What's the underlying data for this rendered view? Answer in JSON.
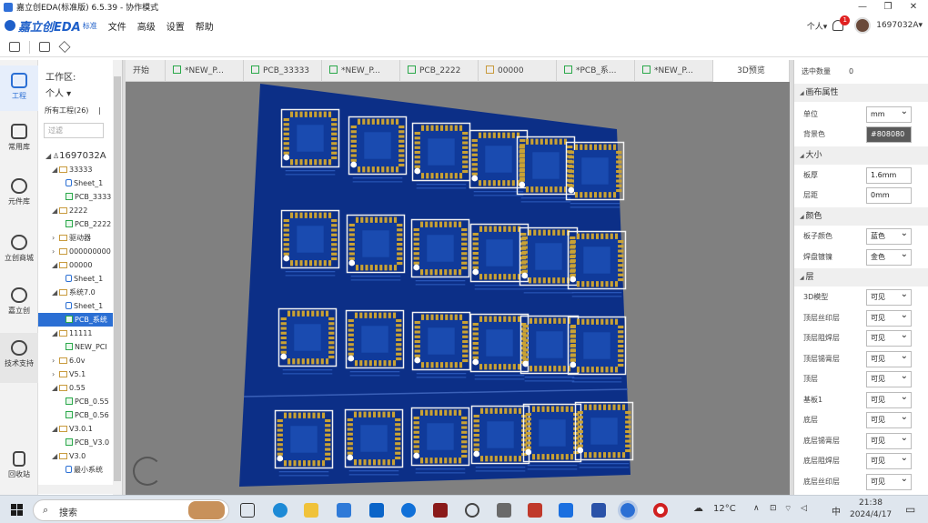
{
  "window": {
    "title": "嘉立创EDA(标准版) 6.5.39 - 协作模式",
    "minimize": "—",
    "maximize": "❐",
    "close": "✕"
  },
  "menubar": {
    "brand": "嘉立创EDA",
    "brand_suffix": "标准",
    "items": [
      "文件",
      "高级",
      "设置",
      "帮助"
    ],
    "personal": "个人▾",
    "notifications": "1",
    "username": "1697032A▾"
  },
  "rail": {
    "items": [
      {
        "label": "工程",
        "icon": "folder-icon",
        "active": true
      },
      {
        "label": "常用库",
        "icon": "library-icon"
      },
      {
        "label": "元件库",
        "icon": "component-search-icon"
      },
      {
        "label": "立创商城",
        "icon": "lcsc-store-icon"
      },
      {
        "label": "嘉立创",
        "icon": "jlc-icon"
      },
      {
        "label": "技术支持",
        "icon": "help-icon"
      },
      {
        "label": "回收站",
        "icon": "trash-icon"
      }
    ]
  },
  "project_panel": {
    "workspace_label": "工作区:",
    "workspace_value": "个人 ▾",
    "all_projects": "所有工程(26)",
    "separator": "|",
    "filter_placeholder": "过滤",
    "tree": [
      {
        "depth": 0,
        "type": "user",
        "label": "1697032A",
        "arrow": "◢"
      },
      {
        "depth": 1,
        "type": "folder",
        "label": "33333",
        "arrow": "◢"
      },
      {
        "depth": 2,
        "type": "sch",
        "label": "Sheet_1"
      },
      {
        "depth": 2,
        "type": "pcb",
        "label": "PCB_3333"
      },
      {
        "depth": 1,
        "type": "folder",
        "label": "2222",
        "arrow": "◢"
      },
      {
        "depth": 2,
        "type": "pcb",
        "label": "PCB_2222"
      },
      {
        "depth": 1,
        "type": "folder",
        "label": "驱动器",
        "arrow": "›"
      },
      {
        "depth": 1,
        "type": "folder",
        "label": "000000000",
        "arrow": "›"
      },
      {
        "depth": 1,
        "type": "folder",
        "label": "00000",
        "arrow": "◢"
      },
      {
        "depth": 2,
        "type": "sch",
        "label": "Sheet_1"
      },
      {
        "depth": 1,
        "type": "folder",
        "label": "系统7.0",
        "arrow": "◢"
      },
      {
        "depth": 2,
        "type": "sch",
        "label": "Sheet_1"
      },
      {
        "depth": 2,
        "type": "pcb",
        "label": "PCB_系统",
        "selected": true
      },
      {
        "depth": 1,
        "type": "folder",
        "label": "11111",
        "arrow": "◢"
      },
      {
        "depth": 2,
        "type": "pcb",
        "label": "NEW_PCI"
      },
      {
        "depth": 1,
        "type": "folder",
        "label": "6.0v",
        "arrow": "›"
      },
      {
        "depth": 1,
        "type": "folder",
        "label": "V5.1",
        "arrow": "›"
      },
      {
        "depth": 1,
        "type": "folder",
        "label": "0.55",
        "arrow": "◢"
      },
      {
        "depth": 2,
        "type": "pcb",
        "label": "PCB_0.55"
      },
      {
        "depth": 2,
        "type": "pcb",
        "label": "PCB_0.56"
      },
      {
        "depth": 1,
        "type": "folder",
        "label": "V3.0.1",
        "arrow": "◢"
      },
      {
        "depth": 2,
        "type": "pcb",
        "label": "PCB_V3.0"
      },
      {
        "depth": 1,
        "type": "folder",
        "label": "V3.0",
        "arrow": "◢"
      },
      {
        "depth": 2,
        "type": "sch",
        "label": "最小系统"
      }
    ]
  },
  "tabs": [
    {
      "label": "开始",
      "icon": ""
    },
    {
      "label": "*NEW_P...",
      "icon": "pcb"
    },
    {
      "label": "PCB_33333",
      "icon": "pcb"
    },
    {
      "label": "*NEW_P...",
      "icon": "pcb"
    },
    {
      "label": "PCB_2222",
      "icon": "pcb"
    },
    {
      "label": "00000",
      "icon": "folder"
    },
    {
      "label": "*PCB_系...",
      "icon": "pcb"
    },
    {
      "label": "*NEW_P...",
      "icon": "pcb"
    },
    {
      "label": "3D预览",
      "icon": "",
      "active": true
    }
  ],
  "props": {
    "selected_count_label": "选中数量",
    "selected_count": "0",
    "sections": {
      "canvas": "画布属性",
      "size": "大小",
      "color": "颜色",
      "layer": "层"
    },
    "unit_label": "单位",
    "unit_value": "mm",
    "bg_label": "背景色",
    "bg_value": "#808080",
    "thickness_label": "板厚",
    "thickness_value": "1.6mm",
    "spacing_label": "层距",
    "spacing_value": "0mm",
    "board_color_label": "板子颜色",
    "board_color_value": "蓝色",
    "pad_color_label": "焊盘镀镍",
    "pad_color_value": "金色",
    "layers": [
      {
        "label": "3D模型",
        "value": "可见"
      },
      {
        "label": "顶层丝印层",
        "value": "可见"
      },
      {
        "label": "顶层阻焊层",
        "value": "可见"
      },
      {
        "label": "顶层锡膏层",
        "value": "可见"
      },
      {
        "label": "顶层",
        "value": "可见"
      },
      {
        "label": "基板1",
        "value": "可见"
      },
      {
        "label": "底层",
        "value": "可见"
      },
      {
        "label": "底层锡膏层",
        "value": "可见"
      },
      {
        "label": "底层阻焊层",
        "value": "可见"
      },
      {
        "label": "底层丝印层",
        "value": "可见"
      }
    ]
  },
  "taskbar": {
    "search": "搜索",
    "weather": "12°C",
    "ime": "中",
    "time": "21:38",
    "date": "2024/4/17"
  },
  "colors": {
    "board": "#0c2f87",
    "pad": "#c9a235",
    "canvas_bg": "#808080",
    "accent": "#2b6fd4"
  }
}
